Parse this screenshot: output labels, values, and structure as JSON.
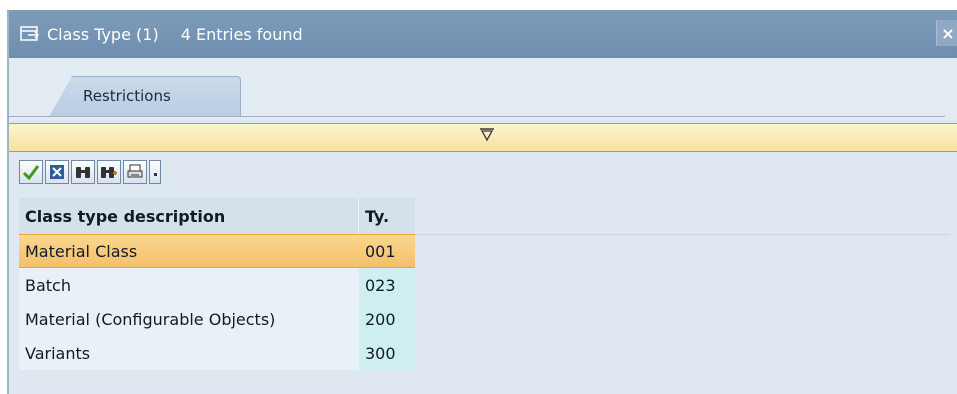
{
  "window": {
    "title": "Class Type (1)",
    "subtitle": "4 Entries found",
    "close_label": "×"
  },
  "tabs": [
    {
      "label": "Restrictions"
    }
  ],
  "toolbar": {
    "buttons": [
      {
        "icon": "checkmark-icon"
      },
      {
        "icon": "cancel-icon"
      },
      {
        "icon": "binoculars-icon"
      },
      {
        "icon": "find-next-icon"
      },
      {
        "icon": "print-icon"
      },
      {
        "icon": "dropdown-arrow-icon"
      }
    ]
  },
  "table": {
    "columns": [
      "Class type description",
      "Ty."
    ],
    "rows": [
      {
        "description": "Material Class",
        "type": "001",
        "selected": true
      },
      {
        "description": "Batch",
        "type": "023",
        "selected": false
      },
      {
        "description": "Material (Configurable Objects)",
        "type": "200",
        "selected": false
      },
      {
        "description": "Variants",
        "type": "300",
        "selected": false
      }
    ]
  },
  "colors": {
    "titlebar": "#7495b6",
    "restriction_bar": "#f8e8ad",
    "selected_row": "#f8cc7d"
  }
}
